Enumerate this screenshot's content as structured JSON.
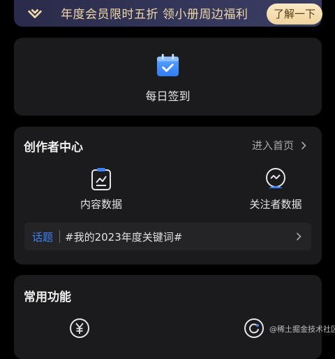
{
  "banner": {
    "text": "年度会员限时五折 领小册周边福利",
    "button": "了解一下",
    "logo_icon": "juejin-logo-icon"
  },
  "checkin": {
    "label": "每日签到",
    "icon": "calendar-check-icon"
  },
  "creator_center": {
    "title": "创作者中心",
    "enter_link": "进入首页",
    "metrics": [
      {
        "label": "内容数据",
        "icon": "content-data-icon"
      },
      {
        "label": "关注者数据",
        "icon": "follower-data-icon"
      }
    ],
    "topic": {
      "tag": "话题",
      "text": "#我的2023年度关键词#"
    }
  },
  "common_functions": {
    "title": "常用功能",
    "items": [
      {
        "icon": "yen-coin-icon"
      },
      {
        "icon": "refresh-circle-icon"
      }
    ]
  },
  "watermark": "@稀土掘金技术社区",
  "colors": {
    "accent": "#3b82f6",
    "card": "#1b1b1d",
    "banner_text": "#efd9a6"
  }
}
